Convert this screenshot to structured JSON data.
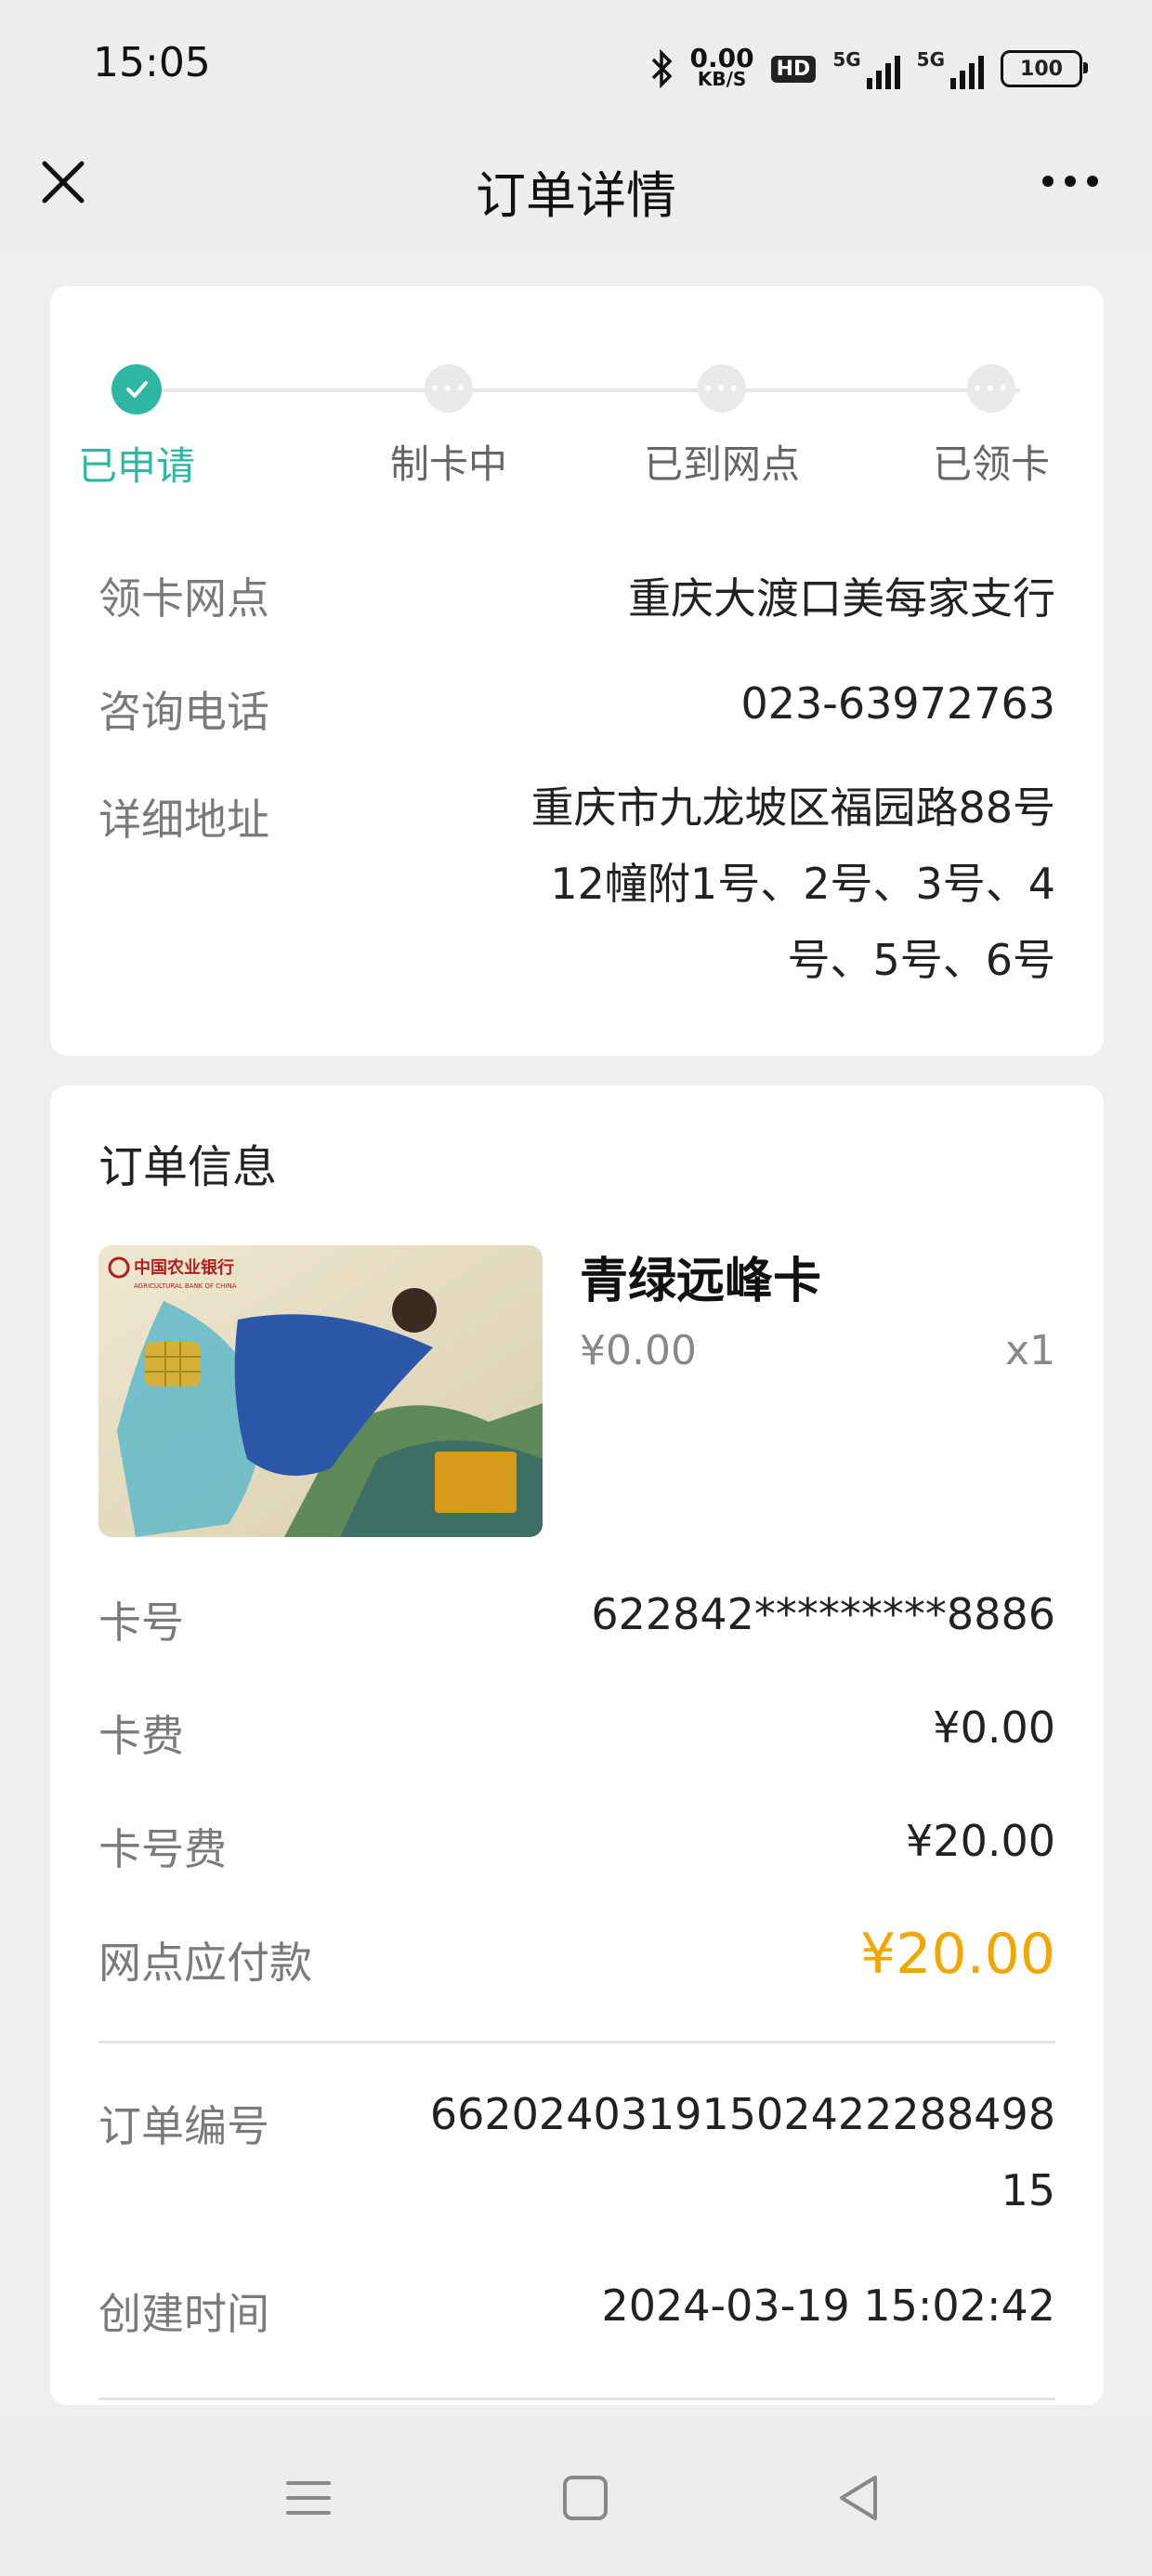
{
  "status_bar": {
    "time": "15:05",
    "net_speed_value": "0.00",
    "net_speed_unit": "KB/S",
    "hd_badge": "HD",
    "signal1_label": "5G",
    "signal2_label": "5G",
    "battery": "100",
    "icons": [
      "bluetooth-icon",
      "hd-icon",
      "signal-5g-icon",
      "signal-5g-icon",
      "battery-icon"
    ]
  },
  "nav": {
    "title": "订单详情",
    "close_icon": "close-icon",
    "more_icon": "more-icon"
  },
  "progress": {
    "steps": [
      {
        "label": "已申请",
        "status": "done"
      },
      {
        "label": "制卡中",
        "status": "pending"
      },
      {
        "label": "已到网点",
        "status": "pending"
      },
      {
        "label": "已领卡",
        "status": "pending"
      }
    ],
    "active_color": "#2fb7a3"
  },
  "branch": {
    "name_label": "领卡网点",
    "name_value": "重庆大渡口美每家支行",
    "phone_label": "咨询电话",
    "phone_value": "023-63972763",
    "address_label": "详细地址",
    "address_lines": [
      "重庆市九龙坡区福园路88号",
      "12幢附1号、2号、3号、4",
      "号、5号、6号"
    ]
  },
  "order": {
    "section_title": "订单信息",
    "card_image_bank_text": "中国农业银行",
    "card_image_bank_en": "AGRICULTURAL BANK OF CHINA",
    "product_name": "青绿远峰卡",
    "product_price": "¥0.00",
    "product_qty": "x1",
    "card_no_label": "卡号",
    "card_no_value": "622842*********8886",
    "card_fee_label": "卡费",
    "card_fee_value": "¥0.00",
    "number_fee_label": "卡号费",
    "number_fee_value": "¥20.00",
    "payable_label": "网点应付款",
    "payable_value": "¥20.00",
    "payable_color": "#f2a600",
    "order_no_label": "订单编号",
    "order_no_lines": [
      "66202403191502422288498",
      "15"
    ],
    "created_label": "创建时间",
    "created_value": "2024-03-19 15:02:42"
  },
  "system_nav": {
    "icons": [
      "menu-icon",
      "home-square-icon",
      "back-triangle-icon"
    ]
  }
}
